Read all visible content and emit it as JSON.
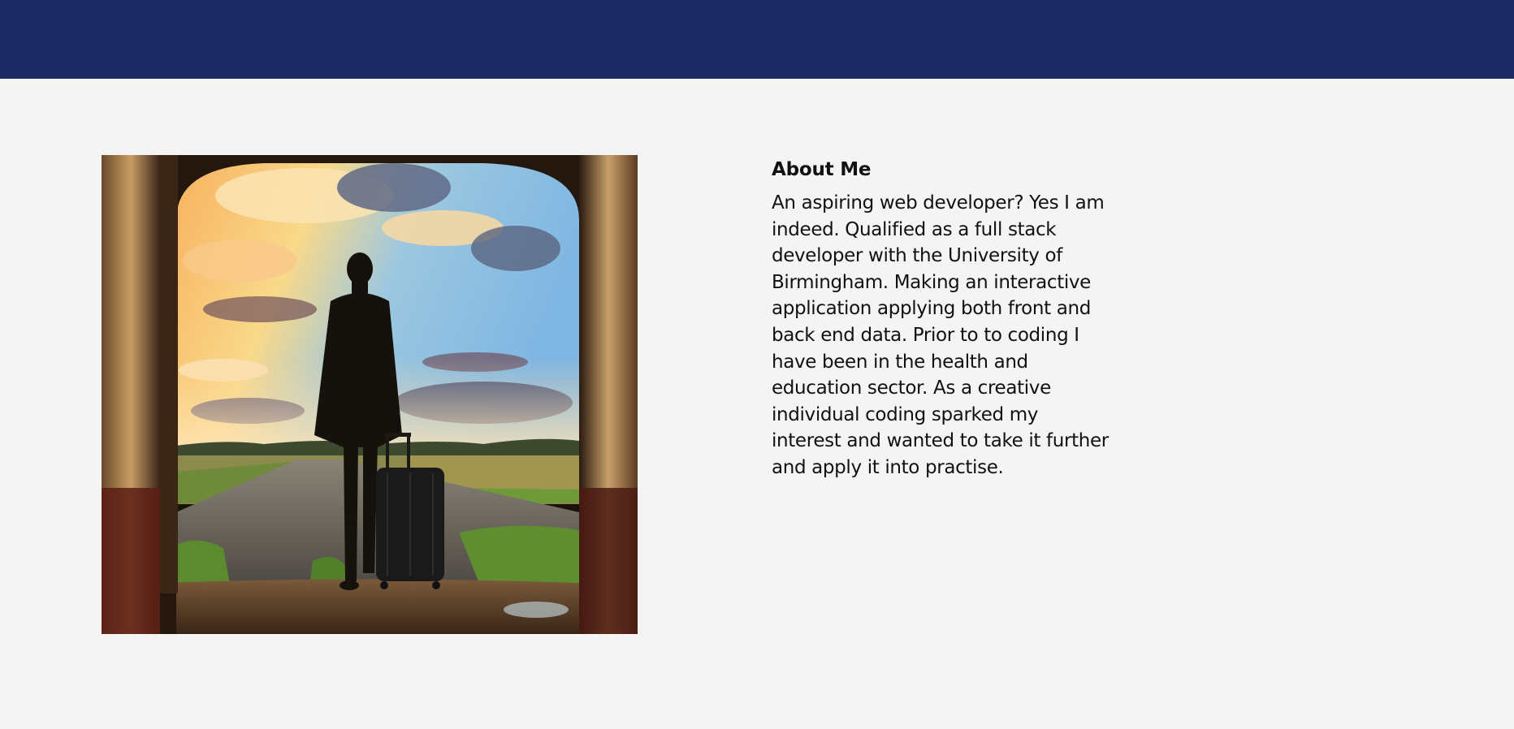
{
  "header": {
    "color": "#1b2a63"
  },
  "hero_image": {
    "subject": "silhouette of a traveller with a suitcase standing in an archway looking at a sunset sky"
  },
  "about": {
    "heading": "About Me",
    "body": "An aspiring web developer? Yes I am indeed. Qualified as a full stack developer with the University of Birmingham. Making an interactive application applying both front and back end data. Prior to to coding I have been in the health and education sector. As a creative individual coding sparked my interest and wanted to take it further and apply it into practise."
  },
  "colors": {
    "page_background": "#f4f4f4",
    "text": "#111111"
  }
}
